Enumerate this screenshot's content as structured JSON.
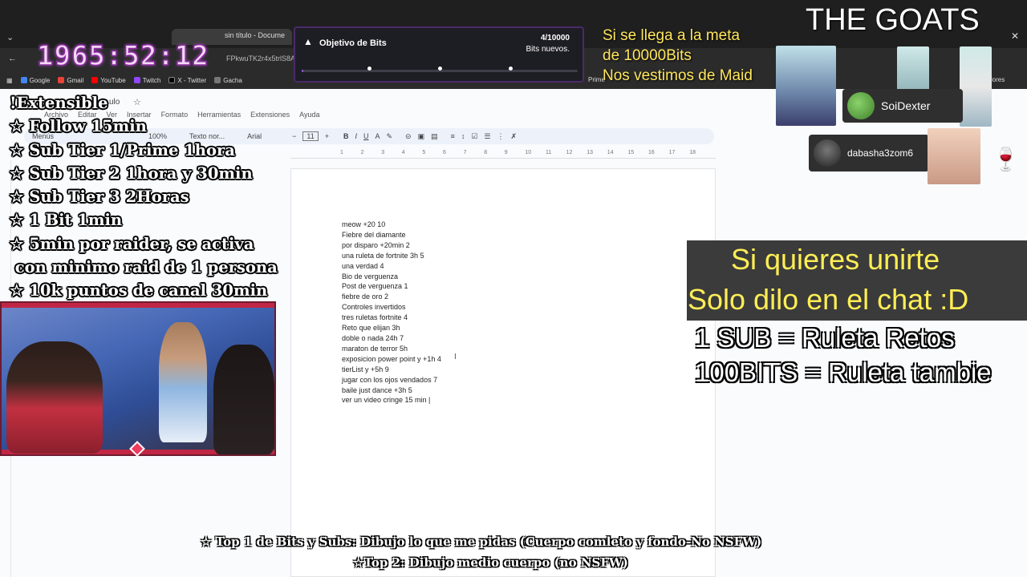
{
  "browser": {
    "tab_title": "sin título - Docume",
    "address": "FPkwuTK2r4x5trlS8A",
    "bookmarks": [
      "Google",
      "Gmail",
      "YouTube",
      "Twitch",
      "X - Twitter",
      "Gacha"
    ],
    "bookmarks_right": [
      "Prime",
      "marcadores"
    ]
  },
  "docs": {
    "title": "ulo",
    "menu": [
      "Archivo",
      "Editar",
      "Ver",
      "Insertar",
      "Formato",
      "Herramientas",
      "Extensiones",
      "Ayuda"
    ],
    "toolbar": {
      "menus": "Menús",
      "zoom": "100%",
      "style": "Texto nor...",
      "font": "Arial",
      "size": "11"
    },
    "ruler_ticks": [
      "1",
      "2",
      "3",
      "4",
      "5",
      "6",
      "7",
      "8",
      "9",
      "10",
      "11",
      "12",
      "13",
      "14",
      "15",
      "16",
      "17",
      "18"
    ],
    "lines": [
      "meow +20 10",
      "Fiebre del diamante",
      "por disparo +20min 2",
      "una ruleta de fortnite 3h 5",
      "una verdad 4",
      "Bio de verguenza",
      "Post de verguenza 1",
      "fiebre de oro 2",
      "Controles invertidos",
      "tres ruletas fortnite 4",
      "Reto que elijan 3h",
      "doble o nada 24h 7",
      "maraton de terror 5h",
      "exposicion power point y +1h 4",
      "tierList y +5h 9",
      "jugar con los ojos vendados 7",
      "baile just dance +3h 5",
      "ver un video cringe 15 min |"
    ]
  },
  "overlay": {
    "timer": "1965:52:12",
    "bits_goal": {
      "title": "Objetivo de Bits",
      "count": "4/10000",
      "subtitle": "Bits nuevos.",
      "progress": 0.0004
    },
    "meta": [
      "Si se llega a la meta",
      "de 10000Bits",
      "Nos vestimos de Maid"
    ],
    "brand": "THE GOATS",
    "rules": [
      "!Extensible",
      "☆ Follow 15min",
      "☆ Sub Tier 1/Prime 1hora",
      "☆ Sub Tier 2 1hora y 30min",
      "☆ Sub Tier 3 2Horas",
      "☆ 1 Bit 1min",
      "☆ 5min por raider, se activa",
      " con minimo raid de 1 persona",
      "☆ 10k puntos de canal 30min"
    ],
    "members": [
      "SoiDexter",
      "dabasha3zom6"
    ],
    "join": [
      "Si quieres unirte",
      "Solo dilo en el chat :D"
    ],
    "roulette": [
      "1 SUB = Ruleta Retos",
      "100BITS = Ruleta tambie"
    ],
    "bottom": [
      "☆ Top 1 de Bits y Subs: Dibujo lo que me pidas (Cuerpo comleto y fondo-No NSFW)",
      "☆Top 2: Dibujo medio cuerpo (no NSFW)"
    ]
  },
  "colors": {
    "accent_yellow": "#ffee55",
    "bits_purple": "#9b5ad6",
    "cam_frame": "#c12745"
  }
}
